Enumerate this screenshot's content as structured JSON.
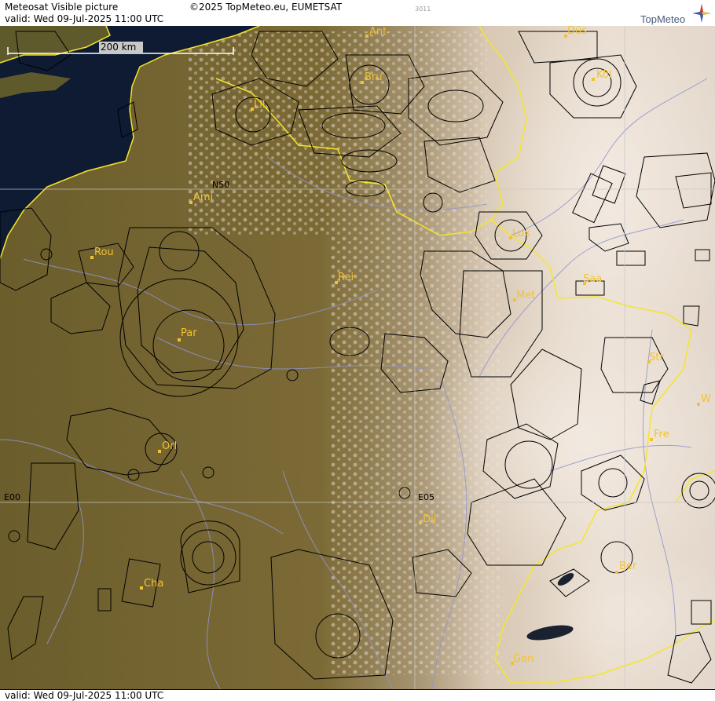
{
  "header": {
    "title": "Meteosat Visible picture",
    "copyright": "©2025 TopMeteo.eu, EUMETSAT",
    "image_code": "3011",
    "valid": "valid:  Wed  09-Jul-2025  11:00 UTC",
    "logo": "TopMeteo"
  },
  "map": {
    "scale_label": "200 km",
    "grid_labels": [
      "N50",
      "E00",
      "E05"
    ],
    "cities": [
      "Ant",
      "Düs",
      "Köl",
      "Bru",
      "Lil",
      "Ami",
      "Lux",
      "Rou",
      "Rei",
      "Saa",
      "Met",
      "Par",
      "Str",
      "W",
      "Fre",
      "Orl",
      "Dij",
      "Ber",
      "Cha",
      "Gen"
    ],
    "colors": {
      "sea": "#0e1b33",
      "border": "#f4e62a",
      "river": "#8f95cf",
      "city_label": "#f2c230",
      "airspace": "#000000"
    }
  },
  "footer": {
    "valid": "valid:  Wed  09-Jul-2025  11:00 UTC"
  }
}
